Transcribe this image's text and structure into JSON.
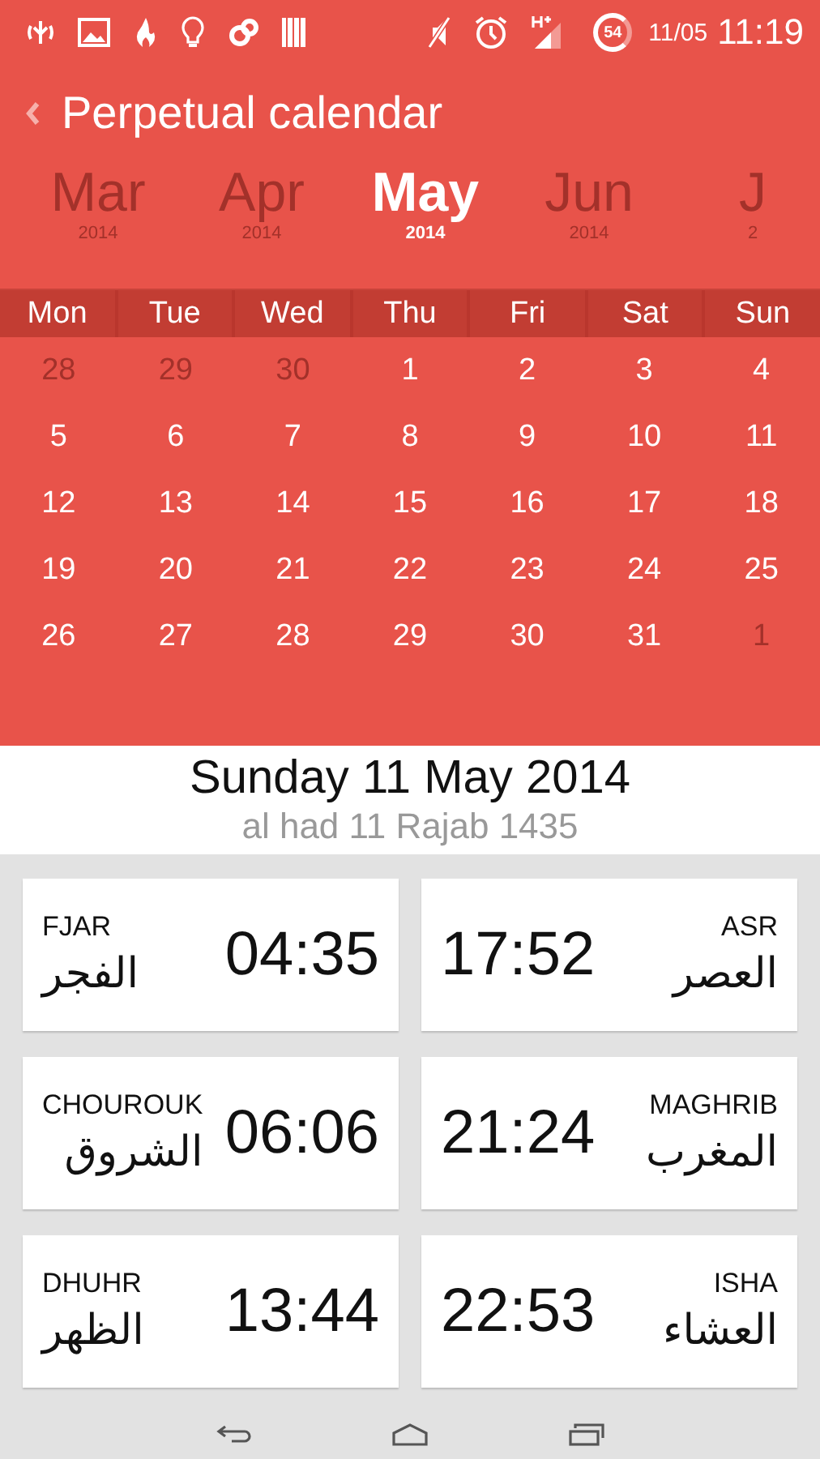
{
  "status_bar": {
    "date": "11/05",
    "time": "11:19",
    "battery": "54"
  },
  "header": {
    "title": "Perpetual calendar"
  },
  "months": [
    {
      "name": "Mar",
      "year": "2014",
      "selected": false
    },
    {
      "name": "Apr",
      "year": "2014",
      "selected": false
    },
    {
      "name": "May",
      "year": "2014",
      "selected": true
    },
    {
      "name": "Jun",
      "year": "2014",
      "selected": false
    },
    {
      "name": "J",
      "year": "2",
      "selected": false
    }
  ],
  "weekdays": [
    "Mon",
    "Tue",
    "Wed",
    "Thu",
    "Fri",
    "Sat",
    "Sun"
  ],
  "weeks": [
    [
      {
        "day": "28",
        "other_month": true
      },
      {
        "day": "29",
        "other_month": true
      },
      {
        "day": "30",
        "other_month": true
      },
      {
        "day": "1",
        "other_month": false
      },
      {
        "day": "2",
        "other_month": false
      },
      {
        "day": "3",
        "other_month": false
      },
      {
        "day": "4",
        "other_month": false
      }
    ],
    [
      {
        "day": "5",
        "other_month": false
      },
      {
        "day": "6",
        "other_month": false
      },
      {
        "day": "7",
        "other_month": false
      },
      {
        "day": "8",
        "other_month": false
      },
      {
        "day": "9",
        "other_month": false
      },
      {
        "day": "10",
        "other_month": false
      },
      {
        "day": "11",
        "other_month": false
      }
    ],
    [
      {
        "day": "12",
        "other_month": false
      },
      {
        "day": "13",
        "other_month": false
      },
      {
        "day": "14",
        "other_month": false
      },
      {
        "day": "15",
        "other_month": false
      },
      {
        "day": "16",
        "other_month": false
      },
      {
        "day": "17",
        "other_month": false
      },
      {
        "day": "18",
        "other_month": false
      }
    ],
    [
      {
        "day": "19",
        "other_month": false
      },
      {
        "day": "20",
        "other_month": false
      },
      {
        "day": "21",
        "other_month": false
      },
      {
        "day": "22",
        "other_month": false
      },
      {
        "day": "23",
        "other_month": false
      },
      {
        "day": "24",
        "other_month": false
      },
      {
        "day": "25",
        "other_month": false
      }
    ],
    [
      {
        "day": "26",
        "other_month": false
      },
      {
        "day": "27",
        "other_month": false
      },
      {
        "day": "28",
        "other_month": false
      },
      {
        "day": "29",
        "other_month": false
      },
      {
        "day": "30",
        "other_month": false
      },
      {
        "day": "31",
        "other_month": false
      },
      {
        "day": "1",
        "other_month": true
      }
    ]
  ],
  "selected_date": {
    "gregorian": "Sunday 11 May 2014",
    "hijri": "al had 11 Rajab 1435"
  },
  "prayers": [
    {
      "name": "FJAR",
      "arabic": "الفجر",
      "time": "04:35",
      "kind": "start"
    },
    {
      "name": "ASR",
      "arabic": "العصر",
      "time": "17:52",
      "kind": "end"
    },
    {
      "name": "CHOUROUK",
      "arabic": "الشروق",
      "time": "06:06",
      "kind": "start"
    },
    {
      "name": "MAGHRIB",
      "arabic": "المغرب",
      "time": "21:24",
      "kind": "end"
    },
    {
      "name": "DHUHR",
      "arabic": "الظهر",
      "time": "13:44",
      "kind": "start"
    },
    {
      "name": "ISHA",
      "arabic": "العشاء",
      "time": "22:53",
      "kind": "end"
    }
  ]
}
